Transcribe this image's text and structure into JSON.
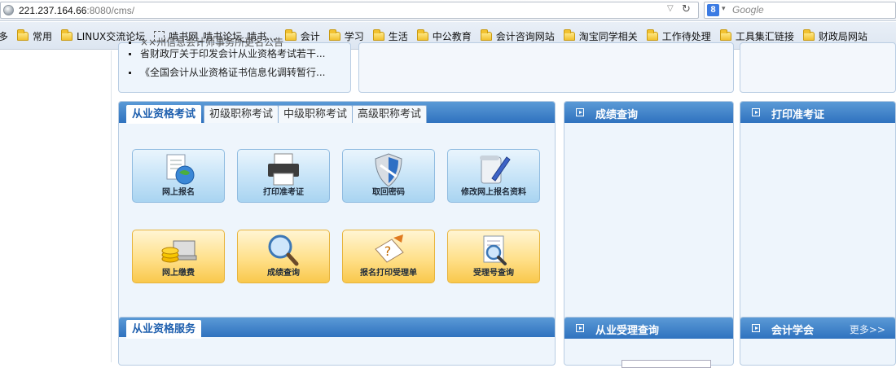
{
  "browser": {
    "url_host": "221.237.164.66",
    "url_rest": ":8080/cms/",
    "search_placeholder": "Google"
  },
  "bookmarks": [
    {
      "label": "最多",
      "icon": "none"
    },
    {
      "label": "常用",
      "icon": "folder-icon"
    },
    {
      "label": "LINUX交流论坛",
      "icon": "folder-icon"
    },
    {
      "label": "啃书网_啃书论坛_啃书...",
      "icon": "page-icon"
    },
    {
      "label": "会计",
      "icon": "folder-icon"
    },
    {
      "label": "学习",
      "icon": "folder-icon"
    },
    {
      "label": "生活",
      "icon": "folder-icon"
    },
    {
      "label": "中公教育",
      "icon": "folder-icon"
    },
    {
      "label": "会计咨询网站",
      "icon": "folder-icon"
    },
    {
      "label": "淘宝同学相关",
      "icon": "folder-icon"
    },
    {
      "label": "工作待处理",
      "icon": "folder-icon"
    },
    {
      "label": "工具集汇链接",
      "icon": "folder-icon"
    },
    {
      "label": "财政局网站",
      "icon": "folder-icon"
    }
  ],
  "news": {
    "cut_item": "××州信息会计师事务所更名公告",
    "items": [
      "省财政厅关于印发会计从业资格考试若干...",
      "《全国会计从业资格证书信息化调转暂行..."
    ]
  },
  "exam_tabs": [
    {
      "label": "从业资格考试",
      "active": true
    },
    {
      "label": "初级职称考试",
      "active": false
    },
    {
      "label": "中级职称考试",
      "active": false
    },
    {
      "label": "高级职称考试",
      "active": false
    }
  ],
  "tiles": [
    {
      "label": "网上报名",
      "icon": "online-registration-icon",
      "color": "blue"
    },
    {
      "label": "打印准考证",
      "icon": "printer-icon",
      "color": "blue"
    },
    {
      "label": "取回密码",
      "icon": "shield-icon",
      "color": "blue"
    },
    {
      "label": "修改网上报名资料",
      "icon": "edit-document-icon",
      "color": "blue"
    },
    {
      "label": "网上缴费",
      "icon": "coins-laptop-icon",
      "color": "yellow"
    },
    {
      "label": "成绩查询",
      "icon": "magnifier-icon",
      "color": "yellow"
    },
    {
      "label": "报名打印受理单",
      "icon": "help-document-icon",
      "color": "yellow"
    },
    {
      "label": "受理号查询",
      "icon": "document-search-icon",
      "color": "yellow"
    }
  ],
  "side_boxes": {
    "score": {
      "title": "成绩查询"
    },
    "ticket": {
      "title": "打印准考证"
    },
    "accept": {
      "title": "从业受理查询"
    },
    "society": {
      "title": "会计学会",
      "more": "更多>>"
    }
  },
  "service": {
    "tab_label": "从业资格服务"
  },
  "colors": {
    "header_blue": "#2f72bf",
    "tile_blue": "#c5e3f7",
    "tile_yellow": "#ffe08a",
    "panel_bg": "#eef5fc"
  }
}
